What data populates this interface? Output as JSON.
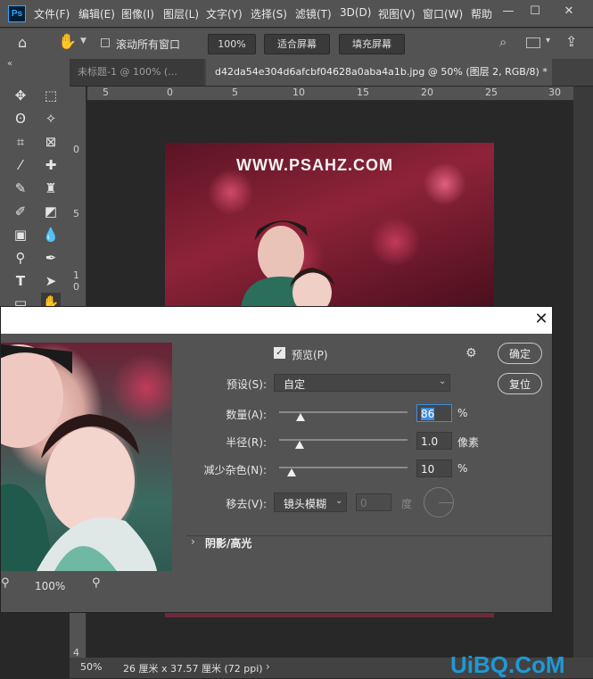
{
  "app": {
    "logo": "Ps"
  },
  "menu": [
    "文件(F)",
    "编辑(E)",
    "图像(I)",
    "图层(L)",
    "文字(Y)",
    "选择(S)",
    "滤镜(T)",
    "3D(D)",
    "视图(V)",
    "窗口(W)",
    "帮助"
  ],
  "window_controls": {
    "minimize": "—",
    "restore": "☐",
    "close": "✕"
  },
  "options": {
    "scroll_all_label": "滚动所有窗口",
    "zoom": "100%",
    "fit_screen": "适合屏幕",
    "fill_screen": "填充屏幕"
  },
  "tabs": [
    {
      "label": "未标题-1 @ 100% (..."
    },
    {
      "label": "d42da54e304d6afcbf04628a0aba4a1b.jpg @ 50% (图层 2, RGB/8) *"
    }
  ],
  "ruler": {
    "h": [
      "5",
      "0",
      "5",
      "10",
      "15",
      "20",
      "25",
      "30"
    ],
    "v": [
      "0",
      "5",
      "1",
      "0",
      "4"
    ]
  },
  "canvas": {
    "watermark": "WWW.PSAHZ.COM"
  },
  "status": {
    "zoom": "50%",
    "doc_info": "26 厘米 x 37.57 厘米 (72 ppi)",
    "arrow": "›"
  },
  "dialog": {
    "close": "✕",
    "preview_label": "预览(P)",
    "preview_checked": true,
    "ok": "确定",
    "reset": "复位",
    "preset_label": "预设(S):",
    "preset_value": "自定",
    "amount_label": "数量(A):",
    "amount_value": "86",
    "amount_unit": "%",
    "amount_level": 0.2,
    "radius_label": "半径(R):",
    "radius_value": "1.0",
    "radius_unit": "像素",
    "reduce_noise_label": "减少杂色(N):",
    "reduce_noise_value": "10",
    "reduce_noise_unit": "%",
    "remove_label": "移去(V):",
    "remove_value": "镜头模糊",
    "angle_value": "0",
    "angle_unit": "度",
    "section_label": "阴影/高光",
    "zoom_value": "100%"
  },
  "watermark_site": "UiBQ.CoM"
}
